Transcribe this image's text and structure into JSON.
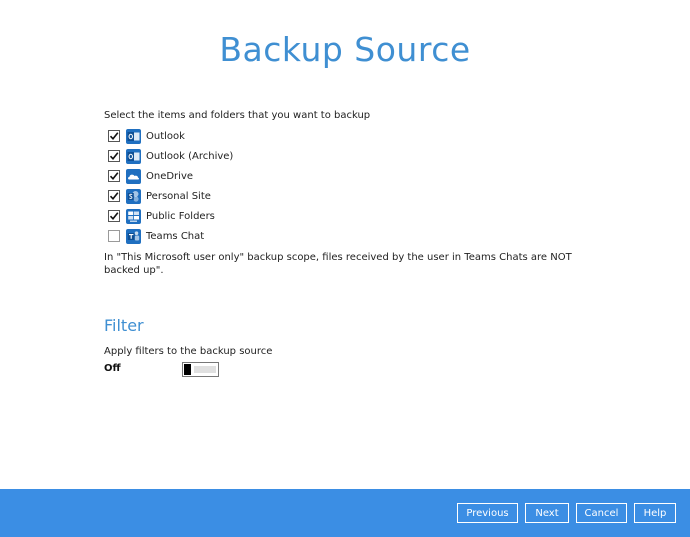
{
  "page": {
    "title": "Backup Source"
  },
  "source": {
    "instruction": "Select the items and folders that you want to backup",
    "items": [
      {
        "label": "Outlook",
        "checked": true,
        "icon": "outlook-icon"
      },
      {
        "label": "Outlook (Archive)",
        "checked": true,
        "icon": "outlook-archive-icon"
      },
      {
        "label": "OneDrive",
        "checked": true,
        "icon": "onedrive-icon"
      },
      {
        "label": "Personal Site",
        "checked": true,
        "icon": "sharepoint-icon"
      },
      {
        "label": "Public Folders",
        "checked": true,
        "icon": "public-folders-icon"
      },
      {
        "label": "Teams Chat",
        "checked": false,
        "icon": "teams-icon"
      }
    ],
    "note": "In \"This Microsoft user only\" backup scope, files received by the user in Teams Chats are NOT backed up\"."
  },
  "filter": {
    "heading": "Filter",
    "description": "Apply filters to the backup source",
    "state_label": "Off",
    "enabled": false
  },
  "footer": {
    "previous_label": "Previous",
    "next_label": "Next",
    "cancel_label": "Cancel",
    "help_label": "Help"
  },
  "colors": {
    "accent": "#3f8fd2",
    "footer_bg": "#3b8ee4",
    "icon_blue": "#1f6fc0"
  }
}
